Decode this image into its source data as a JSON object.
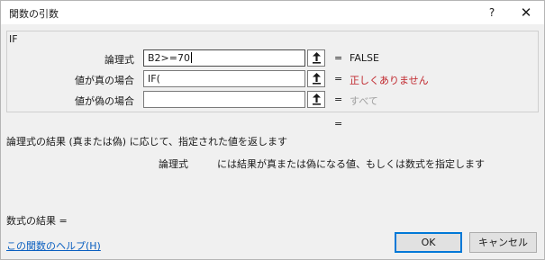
{
  "title": "関数の引数",
  "title_help": "?",
  "title_close": "✕",
  "function_name": "IF",
  "arguments": [
    {
      "label": "論理式",
      "value": "B2>=70",
      "result": "FALSE",
      "result_state": "normal",
      "eq": "="
    },
    {
      "label": "値が真の場合",
      "value": "IF(",
      "result": "正しくありません",
      "result_state": "error",
      "eq": "="
    },
    {
      "label": "値が偽の場合",
      "value": "",
      "result": "すべて",
      "result_state": "muted",
      "eq": "="
    }
  ],
  "eq_under": "=",
  "description": "論理式の結果 (真または偽) に応じて、指定された値を返します",
  "arg_help": {
    "name": "論理式",
    "text": "には結果が真または偽になる値、もしくは数式を指定します"
  },
  "formula_result": "数式の結果 =",
  "help_link": "この関数のヘルプ(H)",
  "buttons": {
    "ok": "OK",
    "cancel": "キャンセル"
  },
  "colors": {
    "error": "#c0262c",
    "link": "#0a5fc0",
    "focus": "#0078d7"
  },
  "icons": {
    "ref": "collapse-dialog-icon"
  }
}
